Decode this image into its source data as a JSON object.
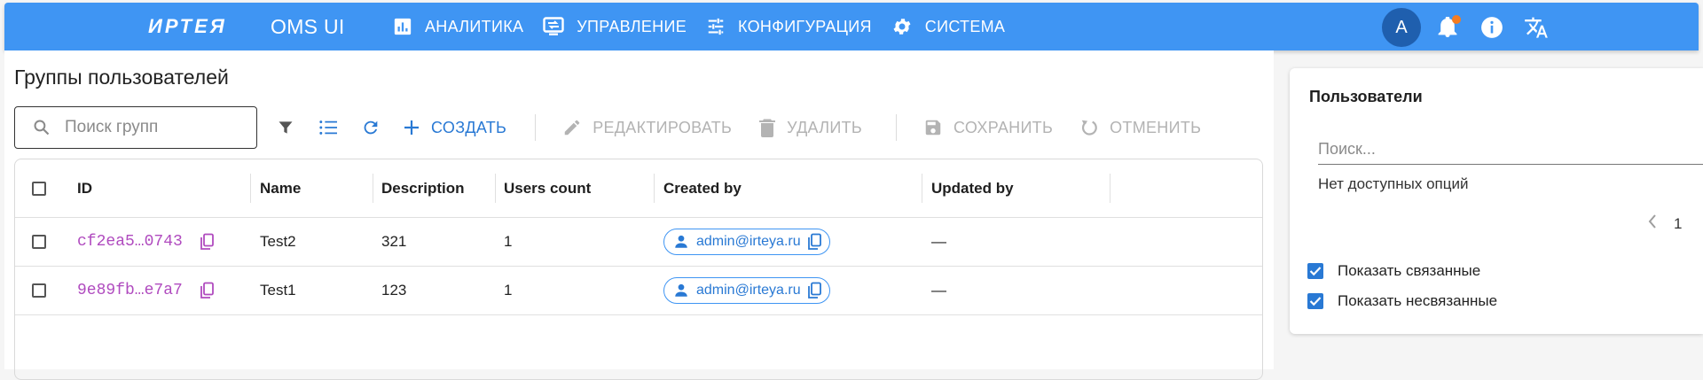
{
  "appbar": {
    "logo": "ИРТЕЯ",
    "app_name": "OMS UI",
    "nav": [
      {
        "label": "АНАЛИТИКА",
        "icon": "analytics-icon"
      },
      {
        "label": "УПРАВЛЕНИЕ",
        "icon": "management-icon"
      },
      {
        "label": "КОНФИГУРАЦИЯ",
        "icon": "tune-icon"
      },
      {
        "label": "СИСТЕМА",
        "icon": "gear-icon"
      }
    ],
    "avatar_letter": "A",
    "icons": [
      "bell-icon",
      "info-icon",
      "translate-icon"
    ]
  },
  "page": {
    "title": "Группы пользователей"
  },
  "toolbar": {
    "search_placeholder": "Поиск групп",
    "create": "СОЗДАТЬ",
    "edit": "РЕДАКТИРОВАТЬ",
    "delete": "УДАЛИТЬ",
    "save": "СОХРАНИТЬ",
    "cancel": "ОТМЕНИТЬ"
  },
  "table": {
    "columns": [
      "ID",
      "Name",
      "Description",
      "Users count",
      "Created by",
      "Updated by"
    ],
    "rows": [
      {
        "id": "cf2ea5…0743",
        "name": "Test2",
        "description": "321",
        "users_count": "1",
        "created_by": "admin@irteya.ru",
        "updated_by": "—"
      },
      {
        "id": "9e89fb…e7a7",
        "name": "Test1",
        "description": "123",
        "users_count": "1",
        "created_by": "admin@irteya.ru",
        "updated_by": "—"
      }
    ]
  },
  "side_panel": {
    "title": "Пользователи",
    "search_placeholder": "Поиск...",
    "empty_text": "Нет доступных опций",
    "page": "1",
    "show_linked": "Показать связанные",
    "show_unlinked": "Показать несвязанные"
  },
  "colors": {
    "primary": "#3f95f3",
    "accent": "#2979d4",
    "id_text": "#b04bbf",
    "notification": "#f57c20"
  }
}
